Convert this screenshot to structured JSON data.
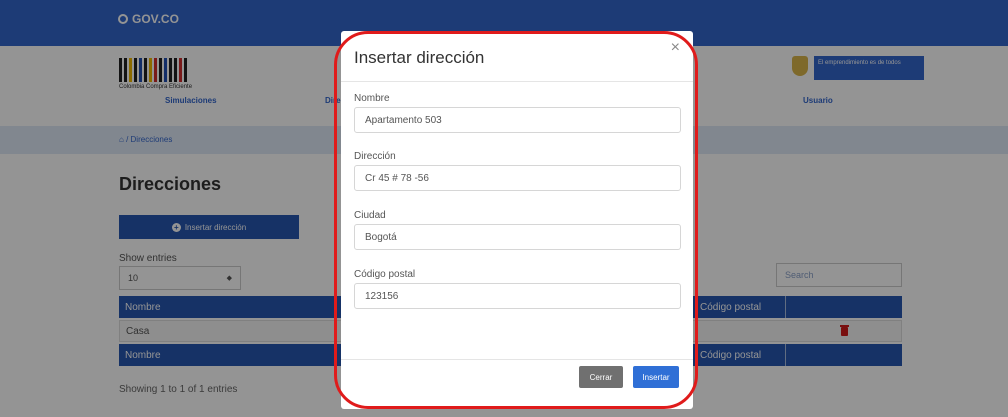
{
  "gov_bar": {
    "logo_text": "GOV.CO",
    "color": "#3366cc"
  },
  "brand": {
    "name": "Colombia Compra Eficiente"
  },
  "partner": {
    "badge_text": "El emprendimiento es de todos"
  },
  "nav": {
    "items": [
      "Simulaciones",
      "Direcciones",
      "Usuario"
    ]
  },
  "breadcrumb": {
    "text": "/ Direcciones"
  },
  "page": {
    "title": "Direcciones",
    "add_button": "Insertar dirección",
    "show_entries_label": "Show entries",
    "show_entries_value": "10",
    "search_placeholder": "Search",
    "showing_text": "Showing 1 to 1 of 1 entries"
  },
  "table": {
    "columns": [
      "Nombre",
      "Código postal"
    ],
    "rows": [
      {
        "nombre": "Casa"
      }
    ],
    "footer_columns": [
      "Nombre",
      "Código postal"
    ]
  },
  "modal": {
    "title": "Insertar dirección",
    "fields": [
      {
        "label": "Nombre",
        "value": "Apartamento 503"
      },
      {
        "label": "Dirección",
        "value": "Cr 45 # 78 -56"
      },
      {
        "label": "Ciudad",
        "value": "Bogotá"
      },
      {
        "label": "Código postal",
        "value": "123156"
      }
    ],
    "close_button": "Cerrar",
    "insert_button": "Insertar"
  },
  "colors": {
    "primary": "#2757b0",
    "highlight": "#e01b1b",
    "delete": "#d11a1a"
  }
}
